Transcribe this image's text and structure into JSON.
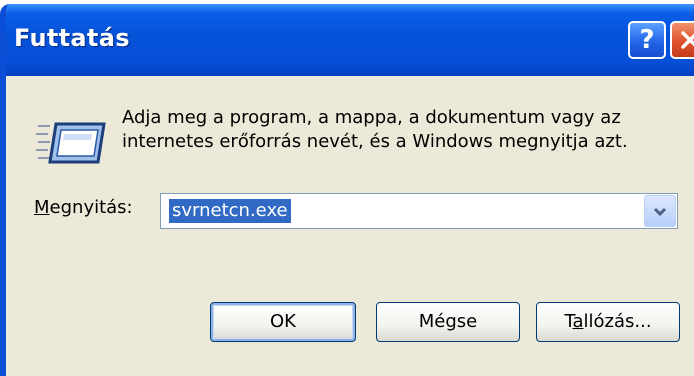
{
  "window": {
    "title": "Futtatás",
    "help_label": "?",
    "close_label": "×"
  },
  "body": {
    "description_line1": "Adja meg a program, a mappa, a dokumentum vagy az",
    "description_line2": "internetes erőforrás nevét, és a Windows megnyitja azt.",
    "open_label_accel": "M",
    "open_label_rest": "egnyitás:",
    "open_value": "svrnetcn.exe"
  },
  "buttons": {
    "ok_label": "OK",
    "cancel_label": "Mégse",
    "browse_prefix": "T",
    "browse_accel": "a",
    "browse_suffix": "llózás..."
  },
  "colors": {
    "titlebar": "#0552d8",
    "dialog_bg": "#ece9d8",
    "selection": "#316ac5",
    "close_button": "#e0522c"
  },
  "icons": [
    "run-icon",
    "help-icon",
    "close-icon",
    "chevron-down-icon"
  ]
}
